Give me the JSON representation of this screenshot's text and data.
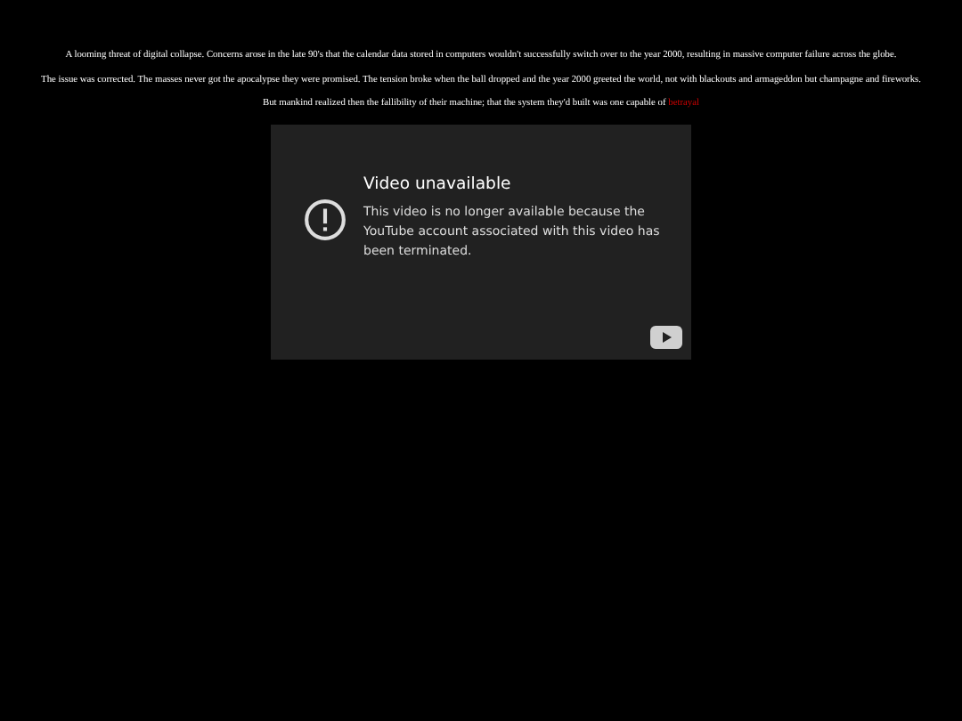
{
  "paragraphs": [
    {
      "text": "A looming threat of digital collapse. Concerns arose in the late 90's that the calendar data stored in computers wouldn't successfully switch over to the year 2000, resulting in massive computer failure across the globe."
    },
    {
      "text": "The issue was corrected. The masses never got the apocalypse they were promised. The tension broke when the ball dropped and the year 2000 greeted the world, not with blackouts and armageddon but champagne and fireworks."
    },
    {
      "text": "But mankind realized then the fallibility of their machine; that the system they'd built was one capable of ",
      "link": "betrayal"
    }
  ],
  "video": {
    "title": "Video unavailable",
    "message": "This video is no longer available because the YouTube account associated with this video has been terminated."
  }
}
